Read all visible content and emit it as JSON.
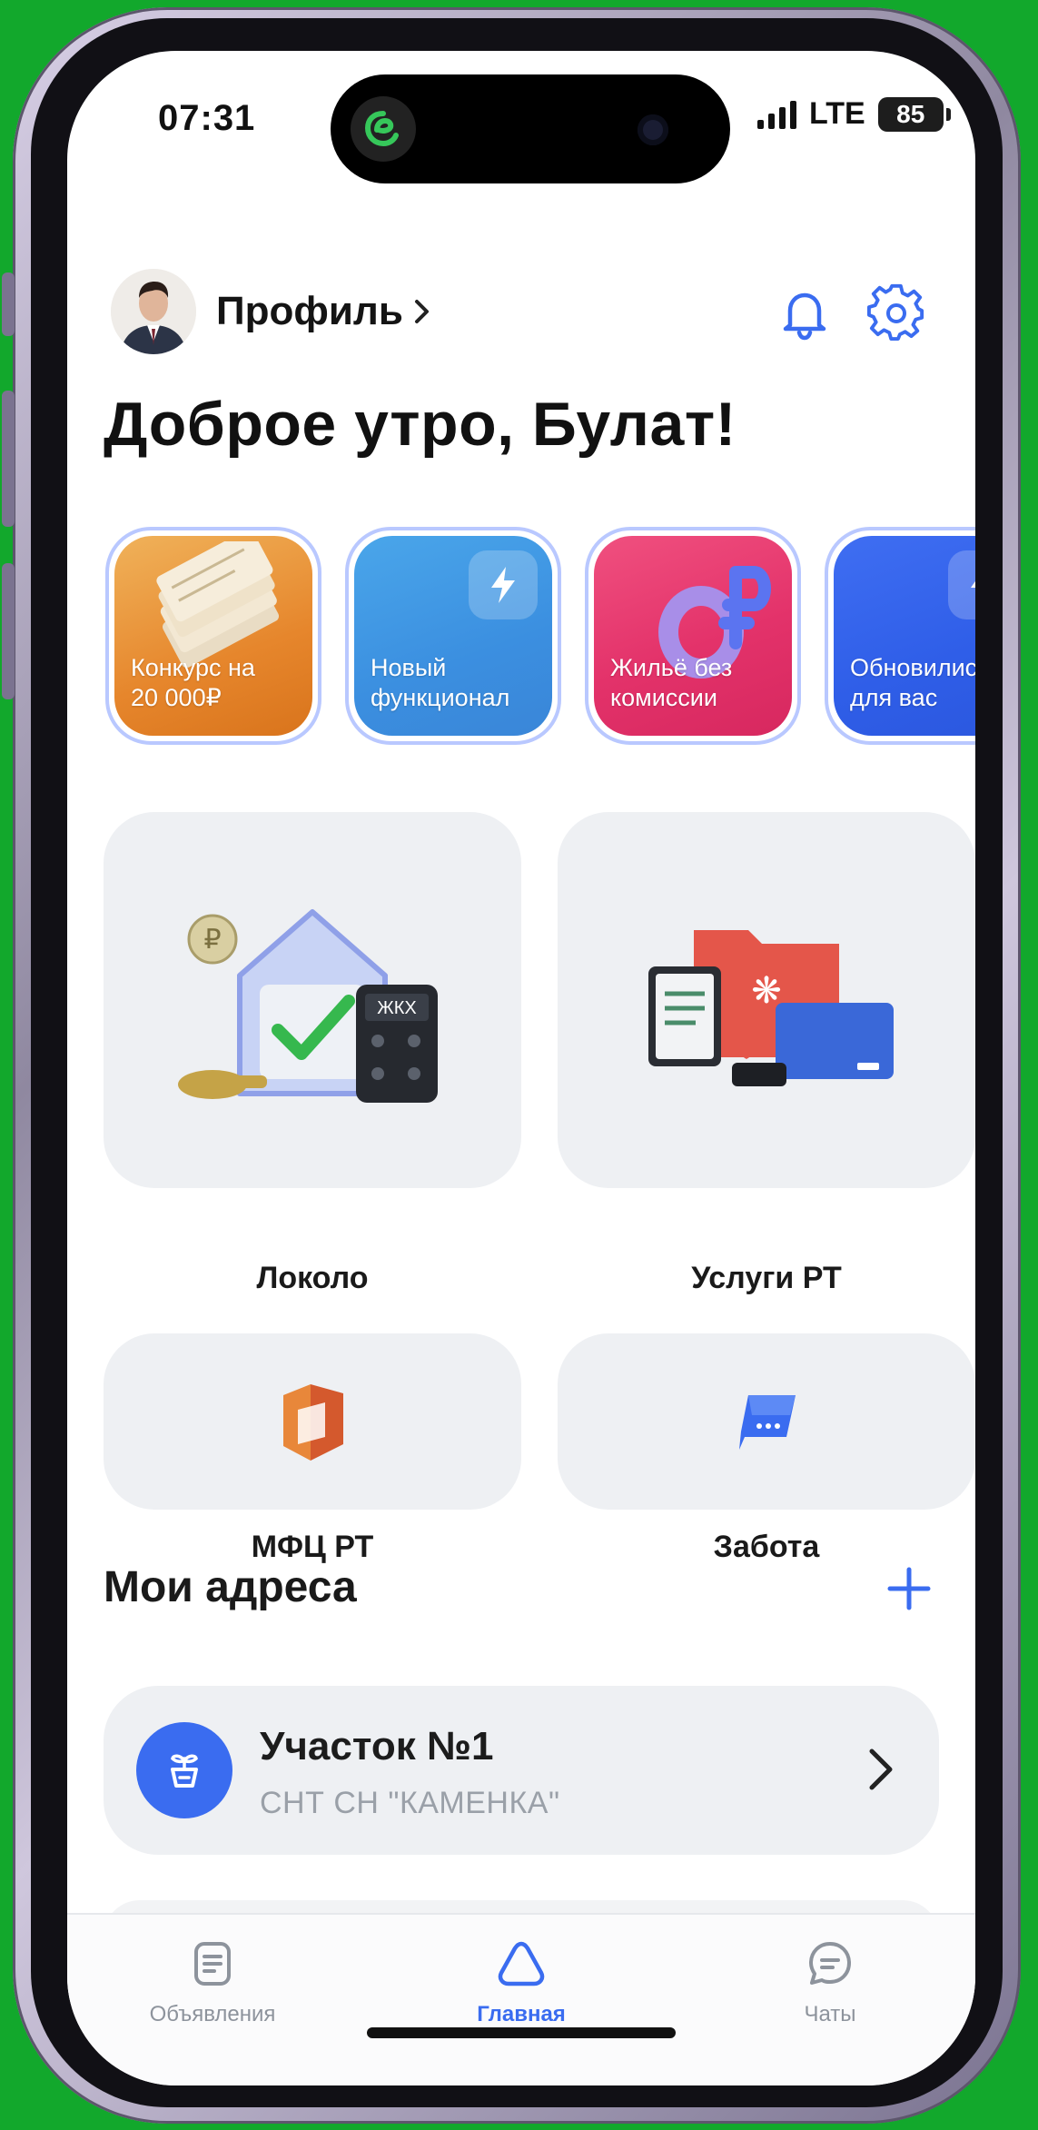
{
  "status_bar": {
    "time": "07:31",
    "network": "LTE",
    "battery": "85"
  },
  "header": {
    "profile_label": "Профиль",
    "profile_chevron": "›"
  },
  "greeting": "Доброе утро, Булат!",
  "stories": [
    {
      "label_line1": "Конкурс на",
      "label_line2": "20 000₽"
    },
    {
      "label_line1": "Новый",
      "label_line2": "функционал"
    },
    {
      "label_line1": "Жильё без",
      "label_line2": "комиссии"
    },
    {
      "label_line1": "Обновились",
      "label_line2": "для вас"
    }
  ],
  "services": [
    {
      "label": "Локоло"
    },
    {
      "label": "Услуги РТ"
    },
    {
      "label": "МФЦ РТ"
    },
    {
      "label": "Забота"
    }
  ],
  "addresses": {
    "title": "Мои адреса",
    "items": [
      {
        "title": "Участок №1",
        "subtitle": "СНТ СН \"КАМЕНКА\""
      }
    ]
  },
  "bottom_nav": {
    "items": [
      {
        "label": "Объявления"
      },
      {
        "label": "Главная"
      },
      {
        "label": "Чаты"
      }
    ]
  },
  "colors": {
    "accent": "#3a6cf0",
    "background": "#ffffff",
    "tile": "#eef0f3",
    "frame_bg": "#12a82c"
  },
  "icons": {
    "bell": "bell-icon",
    "settings": "gear-icon",
    "add": "plus-icon",
    "address": "plant-icon",
    "chevron": "chevron-right-icon"
  }
}
